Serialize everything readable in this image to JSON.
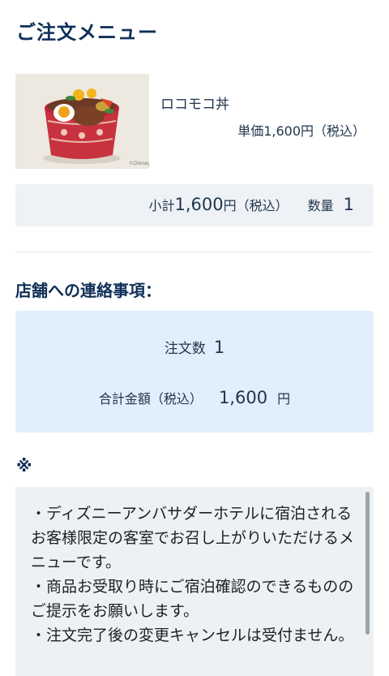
{
  "page": {
    "title": "ご注文メニュー"
  },
  "item": {
    "image_alt": "ロコモコ丼",
    "name": "ロコモコ丼",
    "unit_price": "単価1,600円（税込）"
  },
  "subtotal": {
    "prefix": "小計",
    "amount": "1,600",
    "suffix": "円（税込）",
    "qty_label": "数量",
    "qty_value": "1"
  },
  "store_contact": {
    "title": "店舗への連絡事項：",
    "order_count_label": "注文数",
    "order_count_value": "1",
    "total_label": "合計金額（税込）",
    "total_amount": "1,600",
    "total_unit": "円"
  },
  "notes": {
    "mark": "※",
    "line1": "・ディズニーアンバサダーホテルに宿泊されるお客様限定の客室でお召し上がりいただけるメニューです。",
    "line2": "・商品お受取り時にご宿泊確認のできるもののご提示をお願いします。",
    "line3": "・注文完了後の変更キャンセルは受付ません。"
  },
  "colors": {
    "heading": "#0f2f57",
    "subtotal_bg": "#eef2f6",
    "order_box_bg": "#e1eefb",
    "notes_bg": "#eef1f4"
  }
}
